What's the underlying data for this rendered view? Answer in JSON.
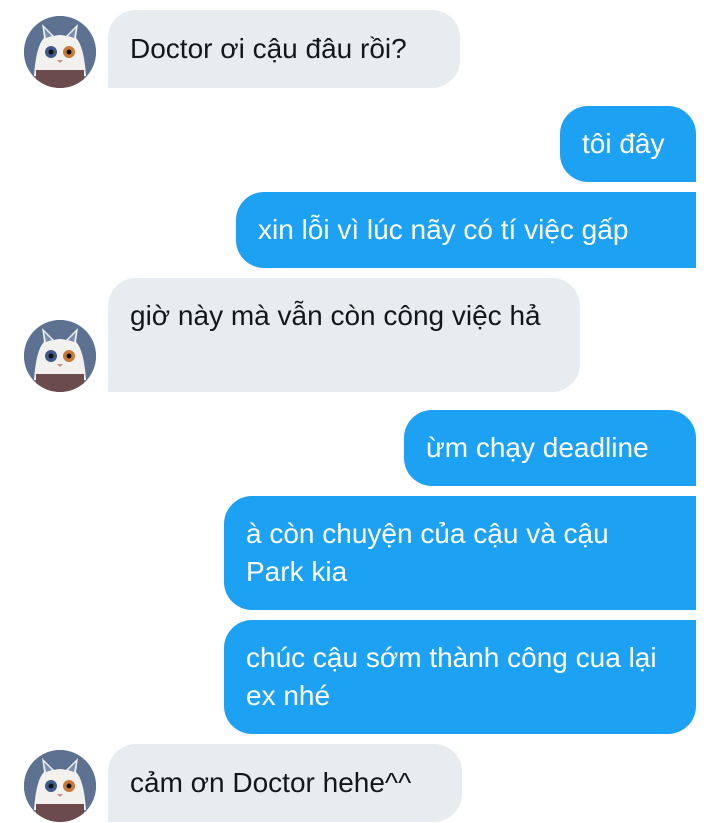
{
  "messages": [
    {
      "from": "them",
      "text": "Doctor ơi cậu đâu rồi?"
    },
    {
      "from": "me",
      "text": "tôi đây"
    },
    {
      "from": "me",
      "text": "xin lỗi vì lúc nãy có tí việc gấp"
    },
    {
      "from": "them",
      "text": "giờ này mà vẫn còn công việc hả"
    },
    {
      "from": "me",
      "text": "ừm chạy deadline"
    },
    {
      "from": "me",
      "text": "à còn chuyện của cậu và cậu Park kia"
    },
    {
      "from": "me",
      "text": "chúc cậu sớm thành công cua lại ex nhé"
    },
    {
      "from": "them",
      "text": "cảm ơn Doctor hehe^^"
    }
  ],
  "colors": {
    "incoming_bubble": "#e6ecf0",
    "outgoing_bubble": "#1da1f2",
    "incoming_text": "#14171a",
    "outgoing_text": "#ffffff"
  },
  "avatar": {
    "icon": "white-cat-avatar-icon"
  }
}
